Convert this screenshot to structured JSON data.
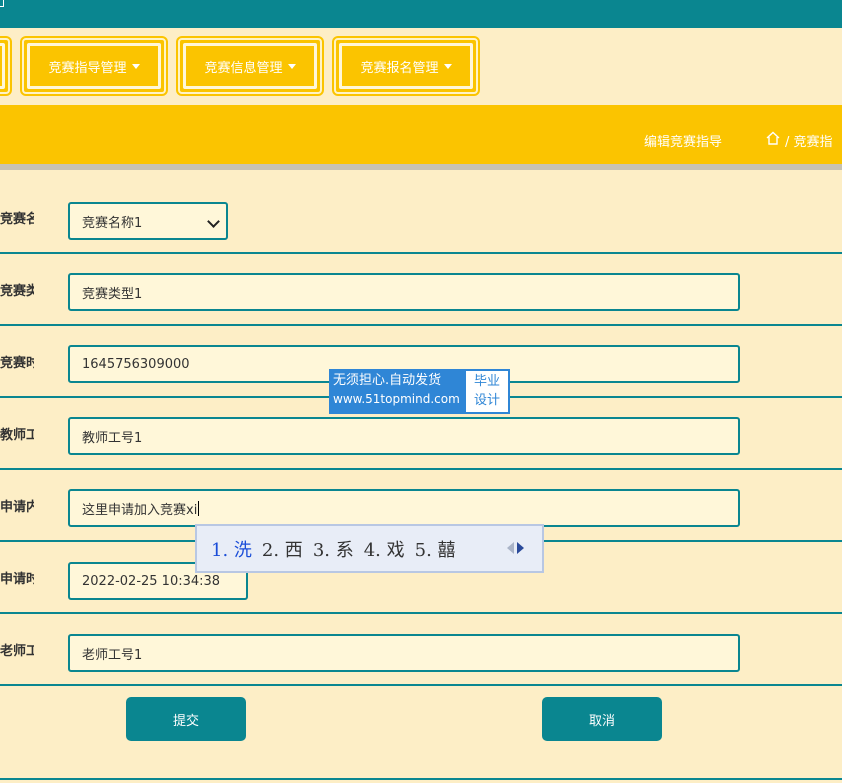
{
  "nav": {
    "items": [
      {
        "label": "竞赛指导管理"
      },
      {
        "label": "竞赛信息管理"
      },
      {
        "label": "竞赛报名管理"
      }
    ]
  },
  "header": {
    "title": "编辑竞赛指导",
    "breadcrumb": "/ 竞赛指"
  },
  "form": {
    "competition_name": {
      "label": "竞赛名称",
      "value": "竞赛名称1"
    },
    "competition_type": {
      "label": "竞赛类型",
      "value": "竞赛类型1"
    },
    "competition_time": {
      "label": "竞赛时间",
      "value": "1645756309000"
    },
    "teacher_id": {
      "label": "教师工号",
      "value": "教师工号1"
    },
    "apply_content": {
      "label": "申请内容",
      "value": "这里申请加入竞赛xi"
    },
    "apply_time": {
      "label": "申请时间",
      "value": "2022-02-25 10:34:38"
    },
    "mentor_id": {
      "label": "老师工号",
      "value": "老师工号1"
    }
  },
  "actions": {
    "submit": "提交",
    "cancel": "取消"
  },
  "watermark": {
    "line1": "无须担心.自动发货",
    "line2": "www.51topmind.com",
    "badge1": "毕业",
    "badge2": "设计"
  },
  "ime": {
    "candidates": [
      "1. 洗",
      "2. 西",
      "3. 系",
      "4. 戏",
      "5. 囍"
    ]
  },
  "colors": {
    "teal": "#0a8690",
    "yellow": "#fbc400",
    "cream": "#fdeec6"
  }
}
